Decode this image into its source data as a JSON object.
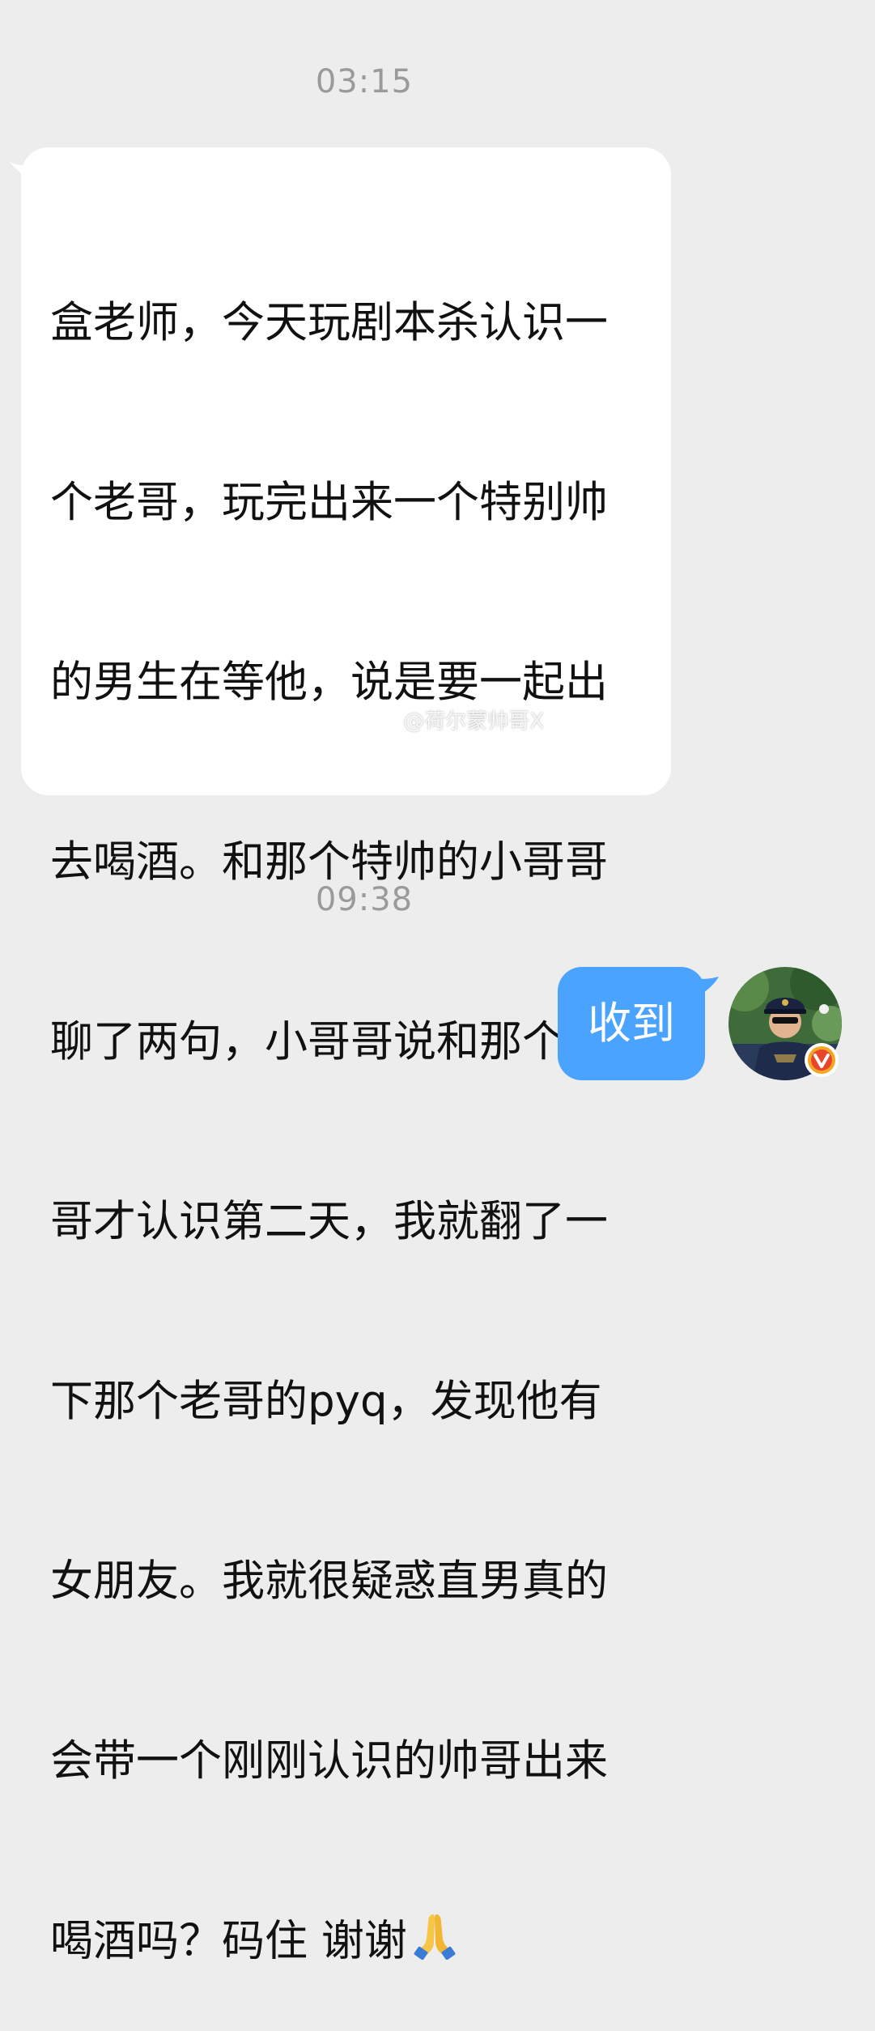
{
  "conversation": {
    "timestamps": [
      "03:15",
      "09:38"
    ],
    "incoming_message": {
      "lines": [
        "盒老师，今天玩剧本杀认识一",
        "个老哥，玩完出来一个特别帅",
        "的男生在等他，说是要一起出",
        "去喝酒。和那个特帅的小哥哥",
        "聊了两句，小哥哥说和那个老",
        "哥才认识第二天，我就翻了一",
        "下那个老哥的pyq，发现他有",
        "女朋友。我就很疑惑直男真的",
        "会带一个刚刚认识的帅哥出来",
        "喝酒吗？码住 谢谢"
      ],
      "trailing_emoji": "pray-emoji"
    },
    "outgoing_message": {
      "text": "收到"
    },
    "watermark": "@荷尔蒙帅哥X"
  },
  "colors": {
    "background": "#ededed",
    "incoming_bubble": "#ffffff",
    "outgoing_bubble": "#4aa3ff",
    "timestamp": "#9a9a9a",
    "badge": "#f5a623"
  },
  "icons": {
    "verified_badge": "verified-v-icon",
    "watermark_logo": "weibo-logo-icon"
  }
}
